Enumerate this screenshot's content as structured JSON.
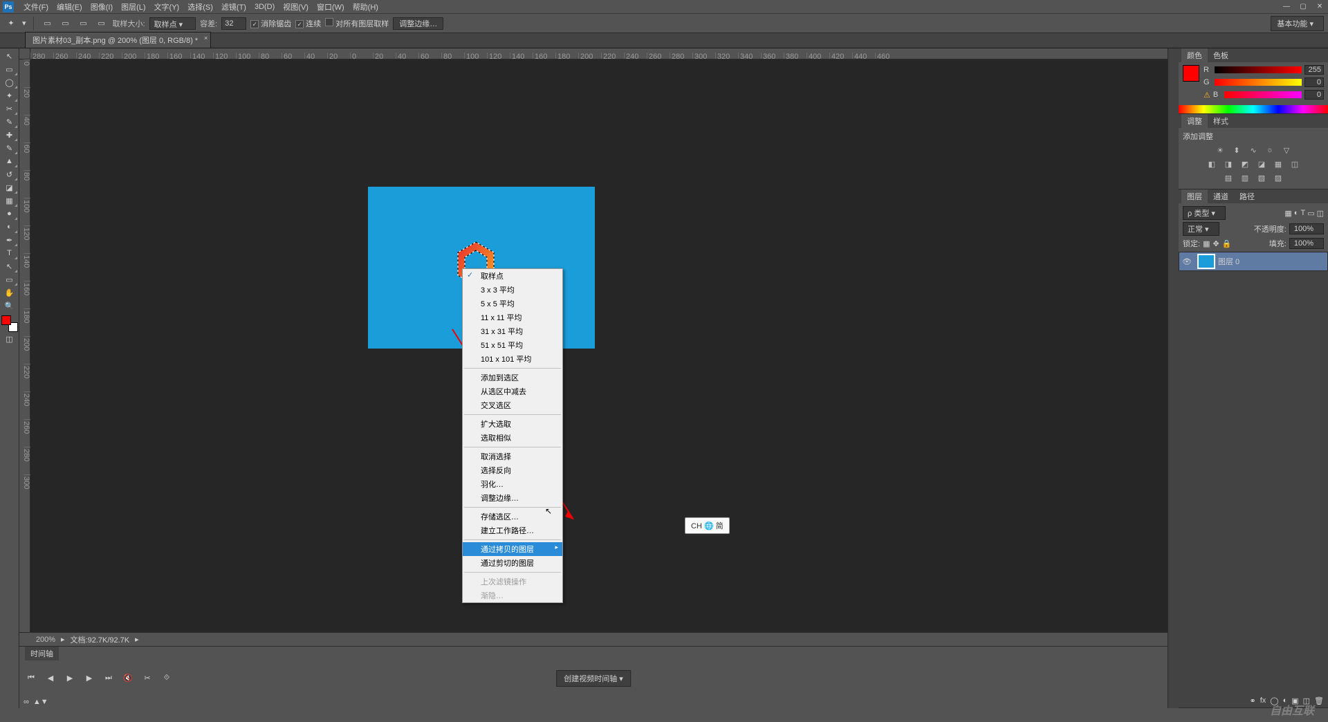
{
  "menubar": {
    "items": [
      "文件(F)",
      "编辑(E)",
      "图像(I)",
      "图层(L)",
      "文字(Y)",
      "选择(S)",
      "滤镜(T)",
      "3D(D)",
      "视图(V)",
      "窗口(W)",
      "帮助(H)"
    ]
  },
  "optionsbar": {
    "sample_size_label": "取样大小:",
    "sample_size_value": "取样点",
    "tolerance_label": "容差:",
    "tolerance_value": "32",
    "anti_alias": "消除锯齿",
    "contiguous": "连续",
    "all_layers": "对所有图层取样",
    "refine_edge": "调整边缘…",
    "workspace_label": "基本功能"
  },
  "doc_tab": {
    "title": "图片素材03_副本.png @ 200% (图层 0, RGB/8) *"
  },
  "ruler_h": [
    "280",
    "260",
    "240",
    "220",
    "200",
    "180",
    "160",
    "140",
    "120",
    "100",
    "80",
    "60",
    "40",
    "20",
    "0",
    "20",
    "40",
    "60",
    "80",
    "100",
    "120",
    "140",
    "160",
    "180",
    "200",
    "220",
    "240",
    "260",
    "280",
    "300",
    "320",
    "340",
    "360",
    "380",
    "400",
    "420",
    "440",
    "460"
  ],
  "ruler_v": [
    "0",
    "20",
    "40",
    "60",
    "80",
    "100",
    "120",
    "140",
    "160",
    "180",
    "200",
    "220",
    "240",
    "260",
    "280",
    "300"
  ],
  "statusbar": {
    "zoom": "200%",
    "doc_info": "文档:92.7K/92.7K"
  },
  "timeline": {
    "tab": "时间轴",
    "create_btn": "创建视频时间轴"
  },
  "color_panel": {
    "tab_color": "颜色",
    "tab_swatch": "色板",
    "r_label": "R",
    "r_val": "255",
    "g_label": "G",
    "g_val": "0",
    "b_label": "B",
    "b_val": "0"
  },
  "adjust_panel": {
    "tab_adjust": "调整",
    "tab_style": "样式",
    "header": "添加调整"
  },
  "layer_panel": {
    "tab_layers": "图层",
    "tab_channels": "通道",
    "tab_paths": "路径",
    "kind_label": "ρ 类型",
    "blend_mode": "正常",
    "opacity_label": "不透明度:",
    "opacity_val": "100%",
    "lock_label": "锁定:",
    "fill_label": "填充:",
    "fill_val": "100%",
    "layer0": "图层 0"
  },
  "context_menu": {
    "items": [
      {
        "text": "取样点",
        "checked": true
      },
      {
        "text": "3 x 3 平均"
      },
      {
        "text": "5 x 5 平均"
      },
      {
        "text": "11 x 11 平均"
      },
      {
        "text": "31 x 31 平均"
      },
      {
        "text": "51 x 51 平均"
      },
      {
        "text": "101 x 101 平均"
      },
      {
        "sep": true
      },
      {
        "text": "添加到选区"
      },
      {
        "text": "从选区中减去"
      },
      {
        "text": "交叉选区"
      },
      {
        "sep": true
      },
      {
        "text": "扩大选取"
      },
      {
        "text": "选取相似"
      },
      {
        "sep": true
      },
      {
        "text": "取消选择"
      },
      {
        "text": "选择反向"
      },
      {
        "text": "羽化…"
      },
      {
        "text": "调整边缘…"
      },
      {
        "sep": true
      },
      {
        "text": "存储选区…"
      },
      {
        "text": "建立工作路径…"
      },
      {
        "sep": true
      },
      {
        "text": "通过拷贝的图层",
        "highlight": true,
        "arrow": true
      },
      {
        "text": "通过剪切的图层"
      },
      {
        "sep": true
      },
      {
        "text": "上次滤镜操作",
        "disabled": true
      },
      {
        "text": "渐隐…",
        "disabled": true
      }
    ]
  },
  "ime": "CH 🌐 简",
  "watermark": "自由互联"
}
